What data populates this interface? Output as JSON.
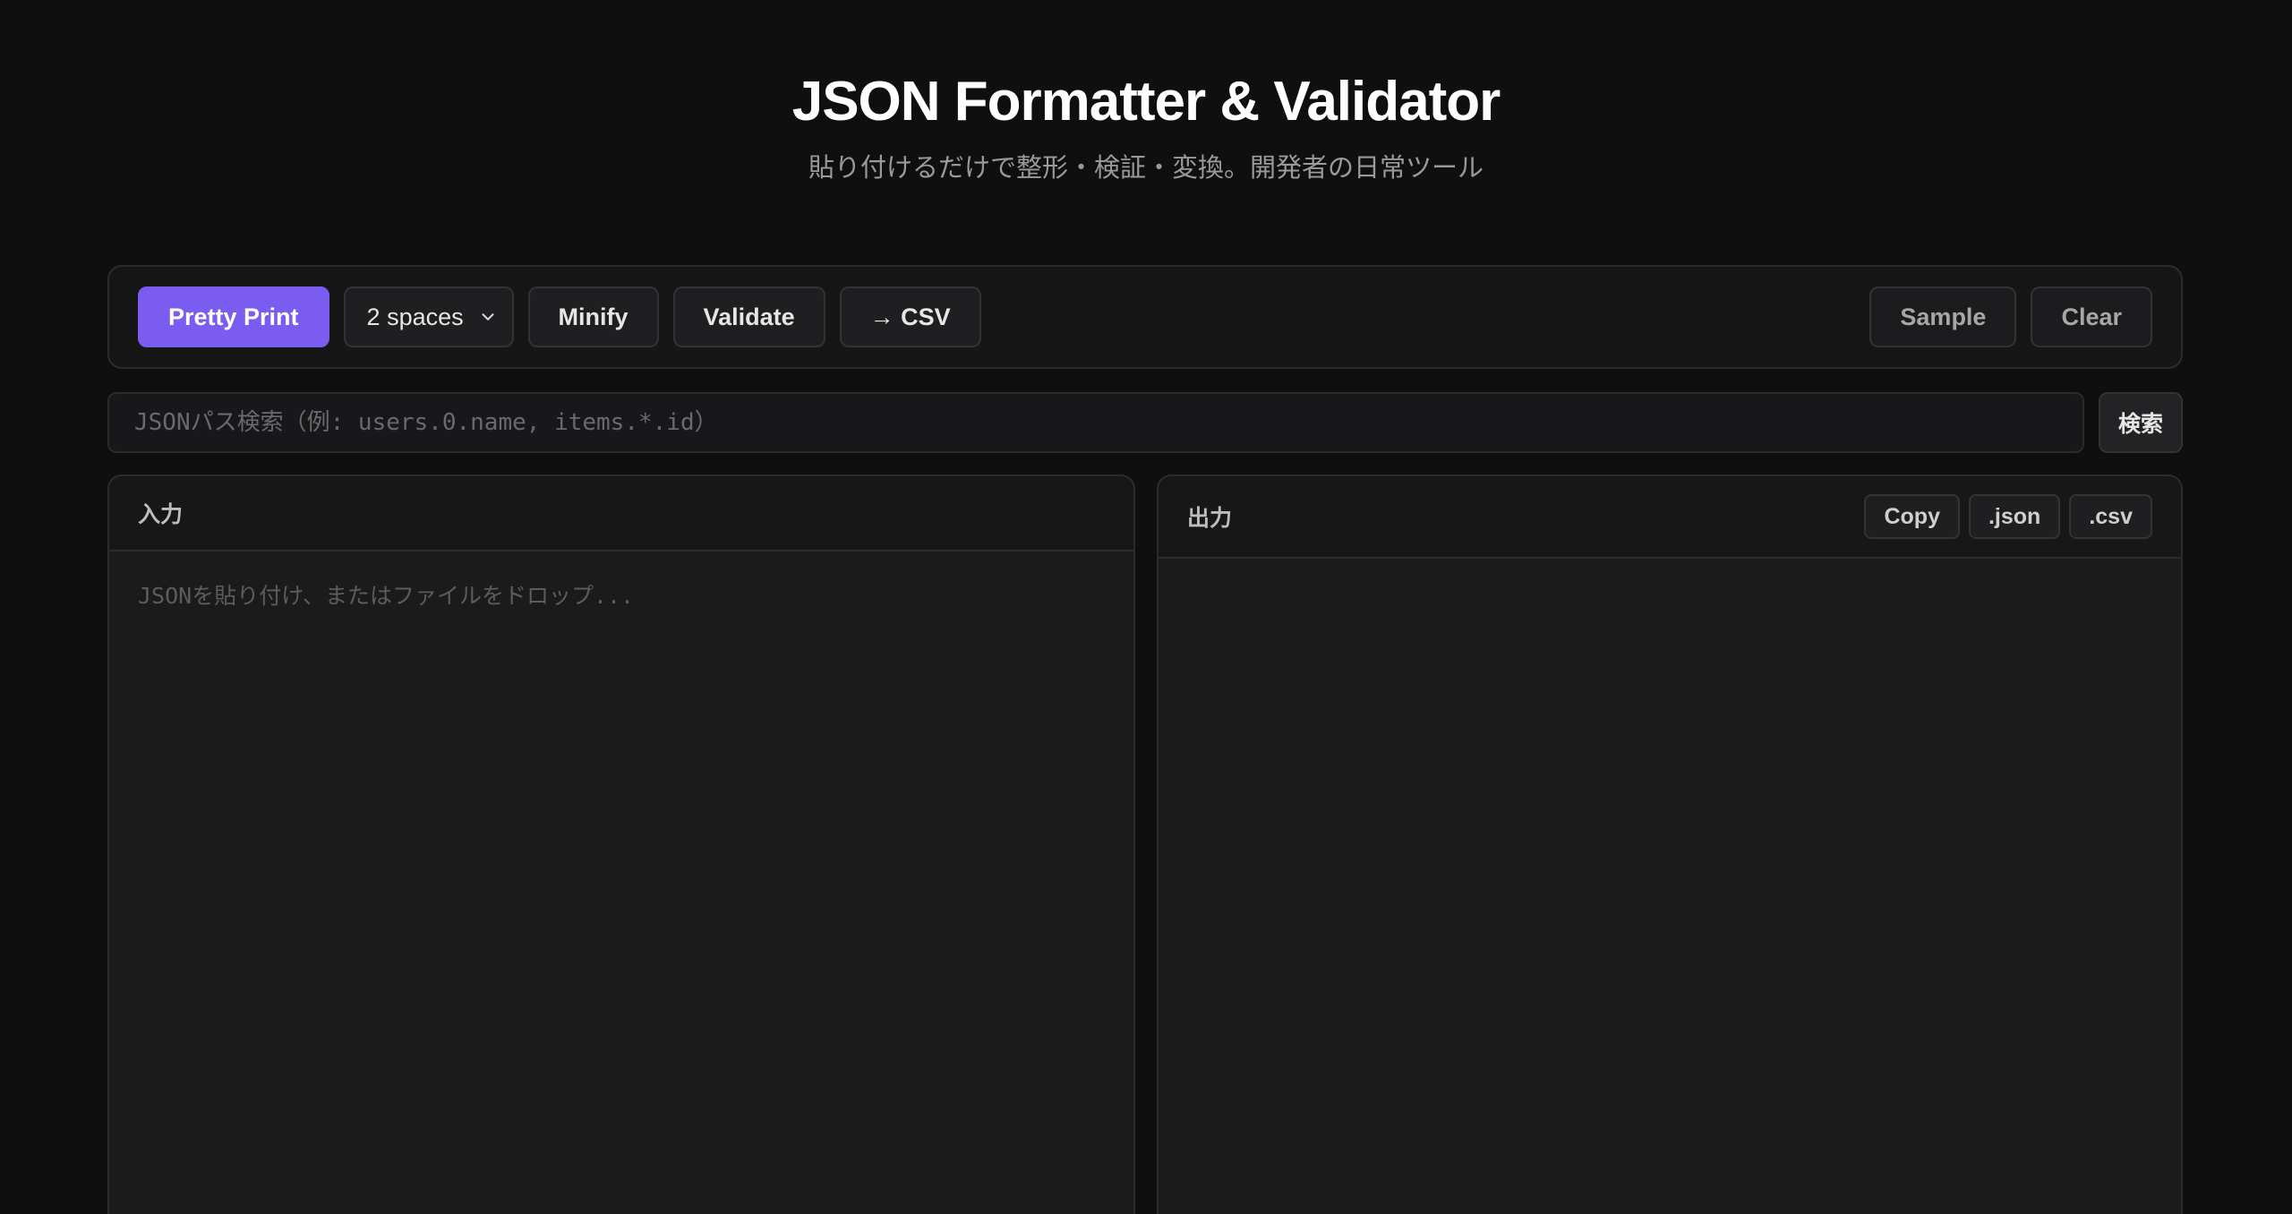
{
  "header": {
    "title": "JSON Formatter & Validator",
    "subtitle": "貼り付けるだけで整形・検証・変換。開発者の日常ツール"
  },
  "toolbar": {
    "pretty_print_label": "Pretty Print",
    "indent_select_value": "2 spaces",
    "minify_label": "Minify",
    "validate_label": "Validate",
    "to_csv_label": "→ CSV",
    "sample_label": "Sample",
    "clear_label": "Clear"
  },
  "path_search": {
    "placeholder": "JSONパス検索（例: users.0.name, items.*.id）",
    "value": "",
    "button_label": "検索"
  },
  "input_panel": {
    "label": "入力",
    "placeholder": "JSONを貼り付け、またはファイルをドロップ...",
    "value": ""
  },
  "output_panel": {
    "label": "出力",
    "copy_label": "Copy",
    "json_label": ".json",
    "csv_label": ".csv",
    "value": ""
  },
  "colors": {
    "background": "#0f0f10",
    "accent": "#7b5cf0",
    "panel": "#1b1b1c",
    "border": "#2c2c2e"
  },
  "icons": {
    "indent_select": "chevron-down-icon"
  }
}
